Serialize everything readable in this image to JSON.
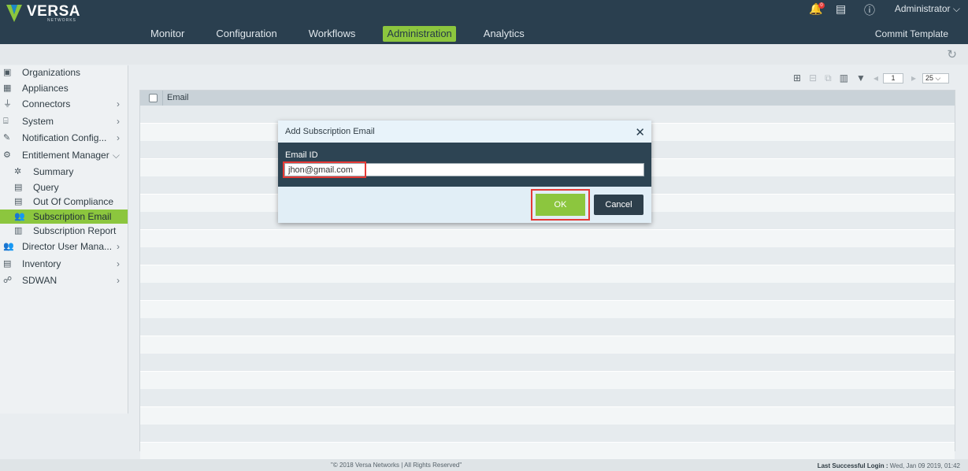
{
  "header": {
    "logo_text": "VERSA",
    "logo_sub": "NETWORKS",
    "notification_count": "0",
    "user": "Administrator",
    "commit_template": "Commit Template",
    "nav": [
      {
        "label": "Monitor"
      },
      {
        "label": "Configuration"
      },
      {
        "label": "Workflows"
      },
      {
        "label": "Administration"
      },
      {
        "label": "Analytics"
      }
    ]
  },
  "sidebar": {
    "items": [
      {
        "label": "Organizations"
      },
      {
        "label": "Appliances"
      },
      {
        "label": "Connectors"
      },
      {
        "label": "System"
      },
      {
        "label": "Notification Config..."
      },
      {
        "label": "Entitlement Manager"
      },
      {
        "label": "Summary"
      },
      {
        "label": "Query"
      },
      {
        "label": "Out Of Compliance"
      },
      {
        "label": "Subscription Email"
      },
      {
        "label": "Subscription Report"
      },
      {
        "label": "Director User Mana..."
      },
      {
        "label": "Inventory"
      },
      {
        "label": "SDWAN"
      }
    ]
  },
  "grid": {
    "column_email": "Email",
    "page": "1",
    "page_size": "25"
  },
  "modal": {
    "title": "Add Subscription Email",
    "field_label": "Email ID",
    "field_value": "jhon@gmail.com",
    "ok_label": "OK",
    "cancel_label": "Cancel"
  },
  "footer": {
    "copyright": "\"© 2018 Versa Networks | All Rights Reserved\"",
    "last_login_label": "Last Successful Login :",
    "last_login_value": "Wed, Jan 09 2019, 01:42"
  },
  "colors": {
    "header_bg": "#2a3f4f",
    "accent_green": "#8cc63e",
    "highlight_red": "#e53935"
  }
}
